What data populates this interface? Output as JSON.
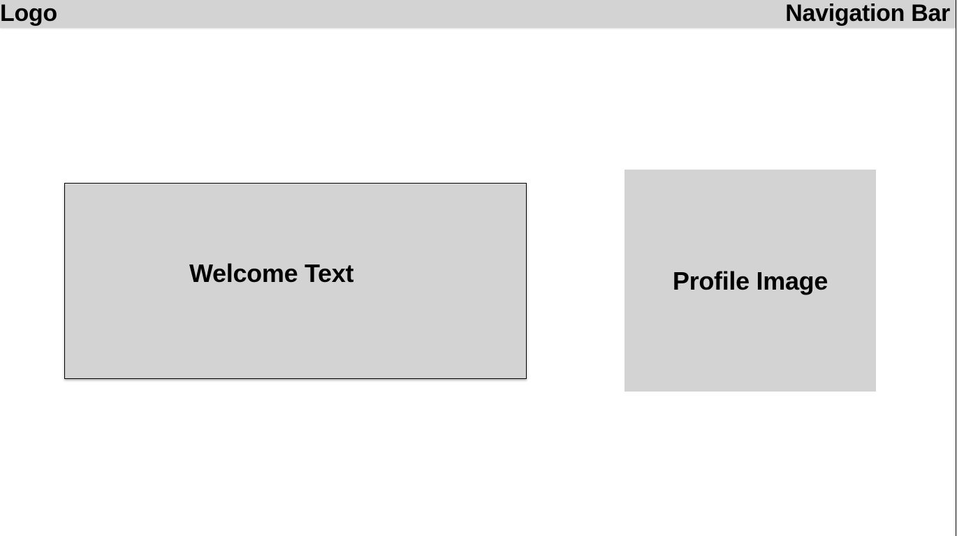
{
  "header": {
    "logo": "Logo",
    "navigation": "Navigation Bar"
  },
  "main": {
    "welcome_text": "Welcome Text",
    "profile_image": "Profile Image"
  },
  "colors": {
    "placeholder_fill": "#d3d3d3",
    "text": "#000000",
    "background": "#ffffff"
  }
}
